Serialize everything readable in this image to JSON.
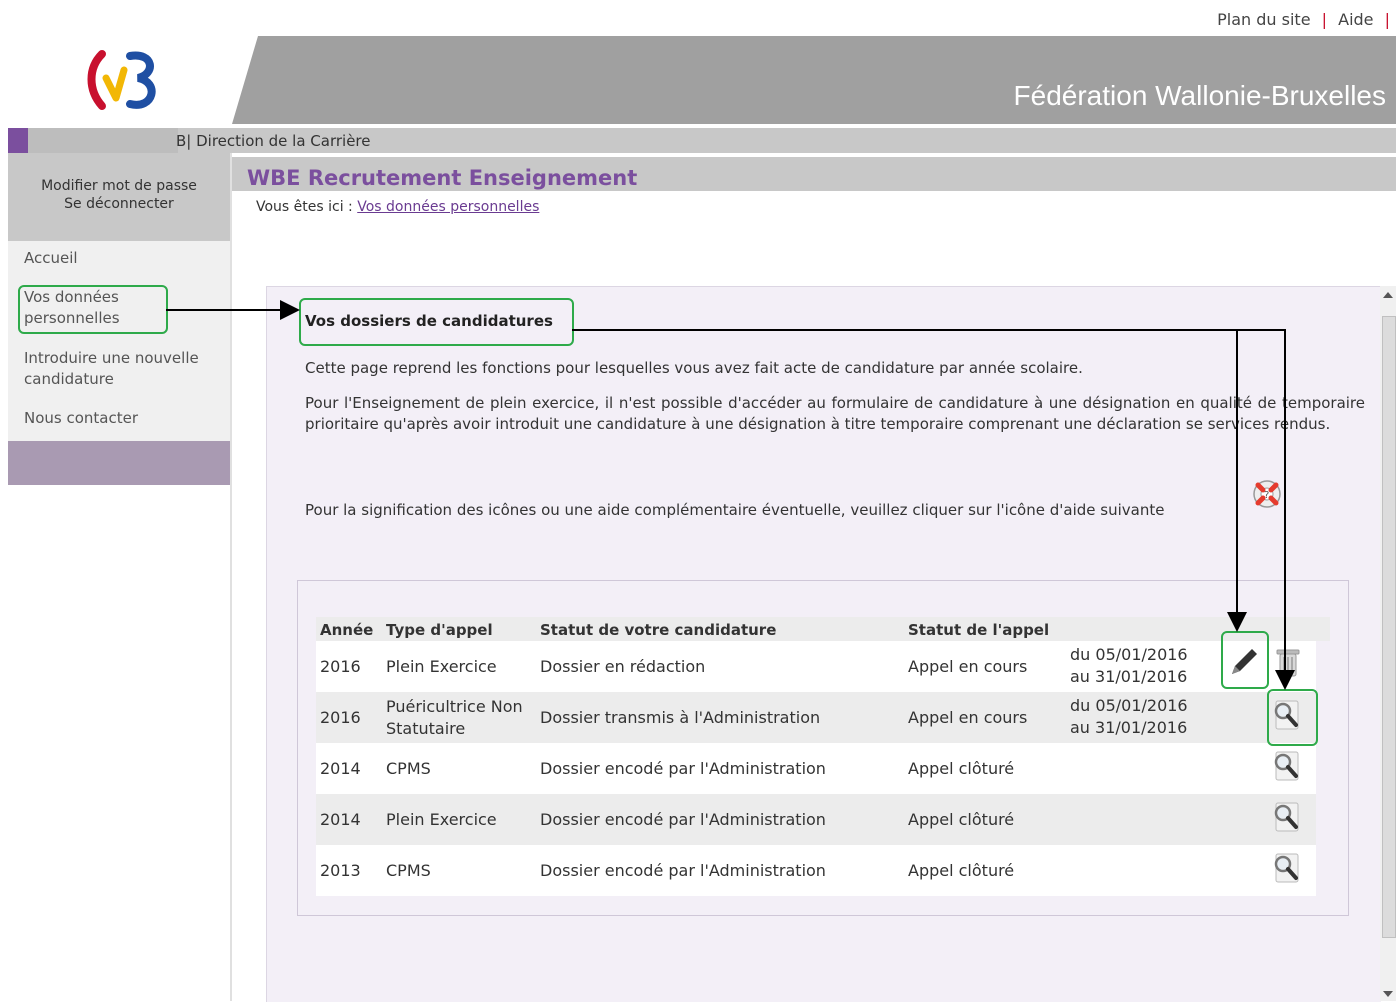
{
  "toplinks": {
    "plan": "Plan du site",
    "sep1": "|",
    "aide": "Aide",
    "sep2": "|"
  },
  "banner": {
    "title": "Fédération Wallonie-Bruxelles"
  },
  "direction": {
    "text": "B| Direction de la Carrière"
  },
  "account": {
    "change_password": "Modifier mot de passe",
    "logout": "Se déconnecter"
  },
  "nav": {
    "accueil": "Accueil",
    "donnees_line1": "Vos données",
    "donnees_line2": "personnelles",
    "nouvelle_line1": "Introduire une nouvelle",
    "nouvelle_line2": "candidature",
    "contact": "Nous contacter"
  },
  "header": {
    "title": "WBE Recrutement Enseignement",
    "breadcrumb_prefix": "Vous êtes ici :",
    "breadcrumb_link": "Vos données personnelles"
  },
  "section": {
    "title": "Vos dossiers de candidatures",
    "para1": "Cette page reprend les fonctions pour lesquelles vous avez fait acte de candidature par année scolaire.",
    "para2": "Pour l'Enseignement de plein exercice, il n'est possible d'accéder au formulaire de candidature à une désignation en qualité de temporaire prioritaire qu'après avoir introduit une candidature à une désignation à titre temporaire comprenant une déclaration se services rendus.",
    "para3": "Pour la signification des icônes ou une aide complémentaire éventuelle, veuillez cliquer sur l'icône d'aide suivante"
  },
  "table": {
    "headers": {
      "annee": "Année",
      "type": "Type d'appel",
      "statut": "Statut de votre candidature",
      "appel": "Statut de l'appel"
    },
    "rows": [
      {
        "annee": "2016",
        "type1": "Plein Exercice",
        "type2": "",
        "statut": "Dossier en rédaction",
        "appel": "Appel en cours",
        "date1": "du 05/01/2016",
        "date2": "au 31/01/2016"
      },
      {
        "annee": "2016",
        "type1": "Puéricultrice Non",
        "type2": "Statutaire",
        "statut": "Dossier transmis à l'Administration",
        "appel": "Appel en cours",
        "date1": "du 05/01/2016",
        "date2": "au 31/01/2016"
      },
      {
        "annee": "2014",
        "type1": "CPMS",
        "type2": "",
        "statut": "Dossier encodé par l'Administration",
        "appel": "Appel clôturé",
        "date1": "",
        "date2": ""
      },
      {
        "annee": "2014",
        "type1": "Plein Exercice",
        "type2": "",
        "statut": "Dossier encodé par l'Administration",
        "appel": "Appel clôturé",
        "date1": "",
        "date2": ""
      },
      {
        "annee": "2013",
        "type1": "CPMS",
        "type2": "",
        "statut": "Dossier encodé par l'Administration",
        "appel": "Appel clôturé",
        "date1": "",
        "date2": ""
      }
    ]
  },
  "colors": {
    "accent": "#7b4f9e",
    "highlight": "#2eaa4a",
    "link": "#6a3b91"
  }
}
